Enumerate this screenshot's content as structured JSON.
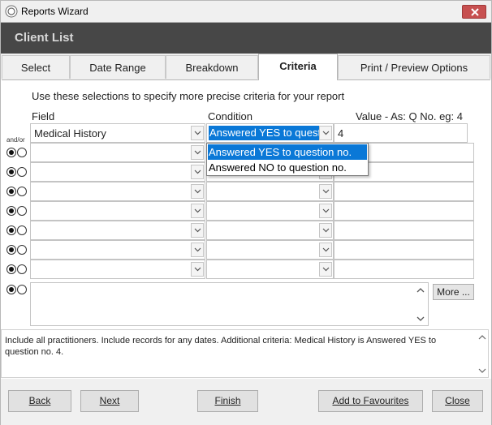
{
  "window": {
    "title": "Reports Wizard",
    "header": "Client List"
  },
  "tabs": [
    {
      "label": "Select",
      "active": false
    },
    {
      "label": "Date Range",
      "active": false
    },
    {
      "label": "Breakdown",
      "active": false
    },
    {
      "label": "Criteria",
      "active": true
    },
    {
      "label": "Print / Preview Options",
      "active": false
    }
  ],
  "criteria": {
    "instruction": "Use selections to specify more precise criteria for your report",
    "instruction_full": "Use these selections to specify more precise criteria for your report",
    "field_header": "Field",
    "condition_header": "Condition",
    "value_header": "Value - As: Q No. eg: 4",
    "andor_label": "and/or",
    "rows": [
      {
        "field": "Medical History",
        "condition": "Answered YES to quest",
        "value": "4"
      },
      {
        "field": "",
        "condition": "",
        "value": ""
      },
      {
        "field": "",
        "condition": "",
        "value": ""
      },
      {
        "field": "",
        "condition": "",
        "value": ""
      },
      {
        "field": "",
        "condition": "",
        "value": ""
      },
      {
        "field": "",
        "condition": "",
        "value": ""
      },
      {
        "field": "",
        "condition": "",
        "value": ""
      },
      {
        "field": "",
        "condition": "",
        "value": ""
      }
    ],
    "condition_options": [
      {
        "label": "Answered YES to question no.",
        "highlighted": true
      },
      {
        "label": "Answered NO to question no.",
        "highlighted": false
      }
    ],
    "more_button": "More ..."
  },
  "summary": "Include all practitioners. Include records for any dates. Additional criteria: Medical History is Answered YES to question no. 4.",
  "footer": {
    "back": "Back",
    "next": "Next",
    "finish": "Finish",
    "add_favourites": "Add to Favourites",
    "close": "Close"
  },
  "colors": {
    "header_band": "#474747",
    "selection": "#0a78d7",
    "close_button": "#c75050"
  }
}
